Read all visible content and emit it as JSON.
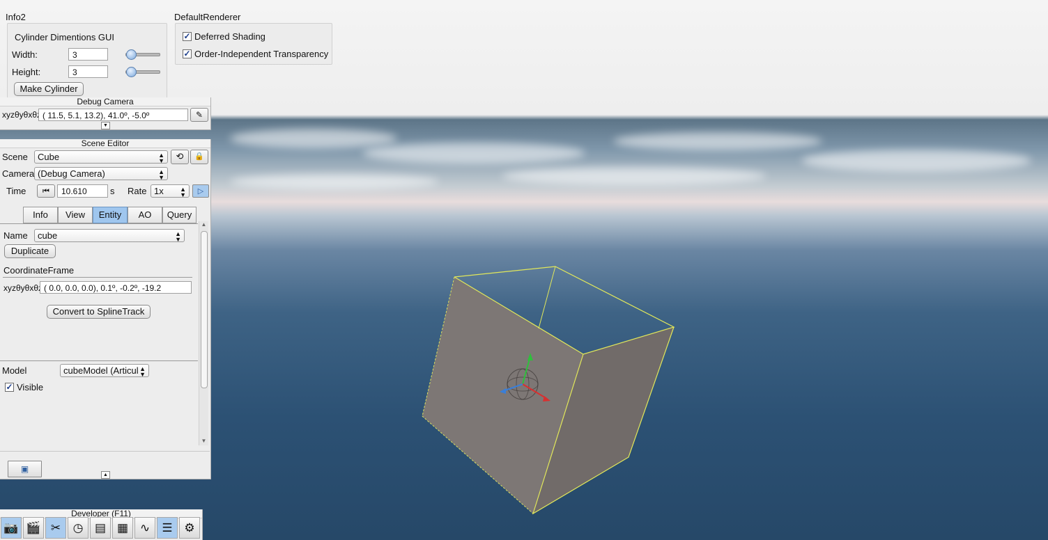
{
  "info2": {
    "window_title": "Info2",
    "group_title": "Cylinder Dimentions GUI",
    "width_label": "Width:",
    "width_value": "3",
    "height_label": "Height:",
    "height_value": "3",
    "make_button": "Make Cylinder"
  },
  "renderer": {
    "window_title": "DefaultRenderer",
    "deferred_label": "Deferred Shading",
    "deferred_checked": true,
    "oit_label": "Order-Independent Transparency",
    "oit_checked": true
  },
  "debug_camera": {
    "title": "Debug Camera",
    "coord_label": "xyzθyθxθz",
    "coord_value": "( 11.5,   5.1,  13.2),  41.0º,  -5.0º"
  },
  "scene_editor": {
    "title": "Scene Editor",
    "scene_label": "Scene",
    "scene_value": "Cube",
    "camera_label": "Camera",
    "camera_value": "(Debug Camera)",
    "time_label": "Time",
    "time_value": "10.610",
    "time_unit": "s",
    "rate_label": "Rate",
    "rate_value": "1x",
    "tabs": [
      "Info",
      "View",
      "Entity",
      "AO",
      "Query"
    ],
    "active_tab": "Entity",
    "name_label": "Name",
    "name_value": "cube",
    "duplicate_button": "Duplicate",
    "frame_section": "CoordinateFrame",
    "frame_label": "xyzθyθxθz",
    "frame_value": "(  0.0,    0.0,    0.0),    0.1º,   -0.2º,  -19.2",
    "convert_button": "Convert to SplineTrack",
    "model_label": "Model",
    "model_value": "cubeModel (Articul",
    "visible_label": "Visible",
    "visible_checked": true
  },
  "developer": {
    "title": "Developer (F11)",
    "tools": [
      "camera-icon",
      "clapperboard-icon",
      "tools-icon",
      "speedometer-icon",
      "window-icon",
      "render-icon",
      "profiler-icon",
      "log-icon",
      "settings-icon"
    ]
  },
  "colors": {
    "active_tab": "#9fc6ee",
    "cube_face": "#7d7775",
    "cube_edge": "#e2e85a"
  }
}
